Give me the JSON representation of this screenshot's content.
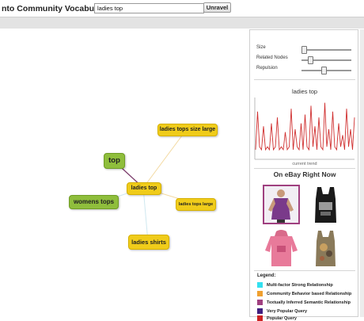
{
  "header": {
    "title": "nto Community Vocabulary",
    "search_value": "ladies top",
    "search_placeholder": "",
    "unravel_label": "Unravel"
  },
  "graph": {
    "center": "ladies top",
    "related": [
      "top",
      "womens tops",
      "ladies tops size large",
      "ladies tops large",
      "ladies shirts"
    ]
  },
  "sidebar": {
    "sliders": [
      {
        "label": "Size",
        "value": 0.02
      },
      {
        "label": "Related Nodes",
        "value": 0.13
      },
      {
        "label": "Repulsion",
        "value": 0.42
      }
    ],
    "trend": {
      "title": "ladies top",
      "caption": "current trend",
      "values": [
        0.15,
        0.8,
        0.2,
        0.15,
        0.55,
        0.15,
        0.2,
        0.15,
        0.6,
        0.15,
        0.2,
        0.7,
        0.15,
        0.2,
        0.15,
        0.45,
        0.15,
        0.2,
        0.85,
        0.15,
        0.5,
        0.2,
        0.15,
        0.6,
        0.15,
        0.75,
        0.2,
        0.15,
        0.9,
        0.2,
        0.55,
        0.15,
        0.7,
        0.2,
        0.15,
        0.95,
        0.2,
        0.5,
        0.15,
        0.8,
        0.2,
        0.15,
        0.6,
        0.2,
        0.4,
        0.15,
        0.85,
        0.2,
        0.5,
        0.15,
        0.7
      ]
    },
    "ebay_title": "On eBay Right Now",
    "products": [
      "purple-top-product",
      "black-tank-top-product",
      "pink-hoodie-product",
      "graphic-tank-top-product"
    ],
    "legend": {
      "title": "Legend:",
      "items": [
        {
          "label": "Multi-factor Strong Relationship",
          "color": "#33e0f0"
        },
        {
          "label": "Community Behavior based Relationship",
          "color": "#f0a030"
        },
        {
          "label": "Textually Inferred Semantic Relationship",
          "color": "#a04080"
        },
        {
          "label": "Very Popular Query",
          "color": "#402080"
        },
        {
          "label": "Popular Query",
          "color": "#cc2222"
        }
      ]
    }
  },
  "colors": {
    "node_yellow": "#f0cc1a",
    "node_green": "#8fbe3c",
    "trend_line": "#d03030"
  }
}
